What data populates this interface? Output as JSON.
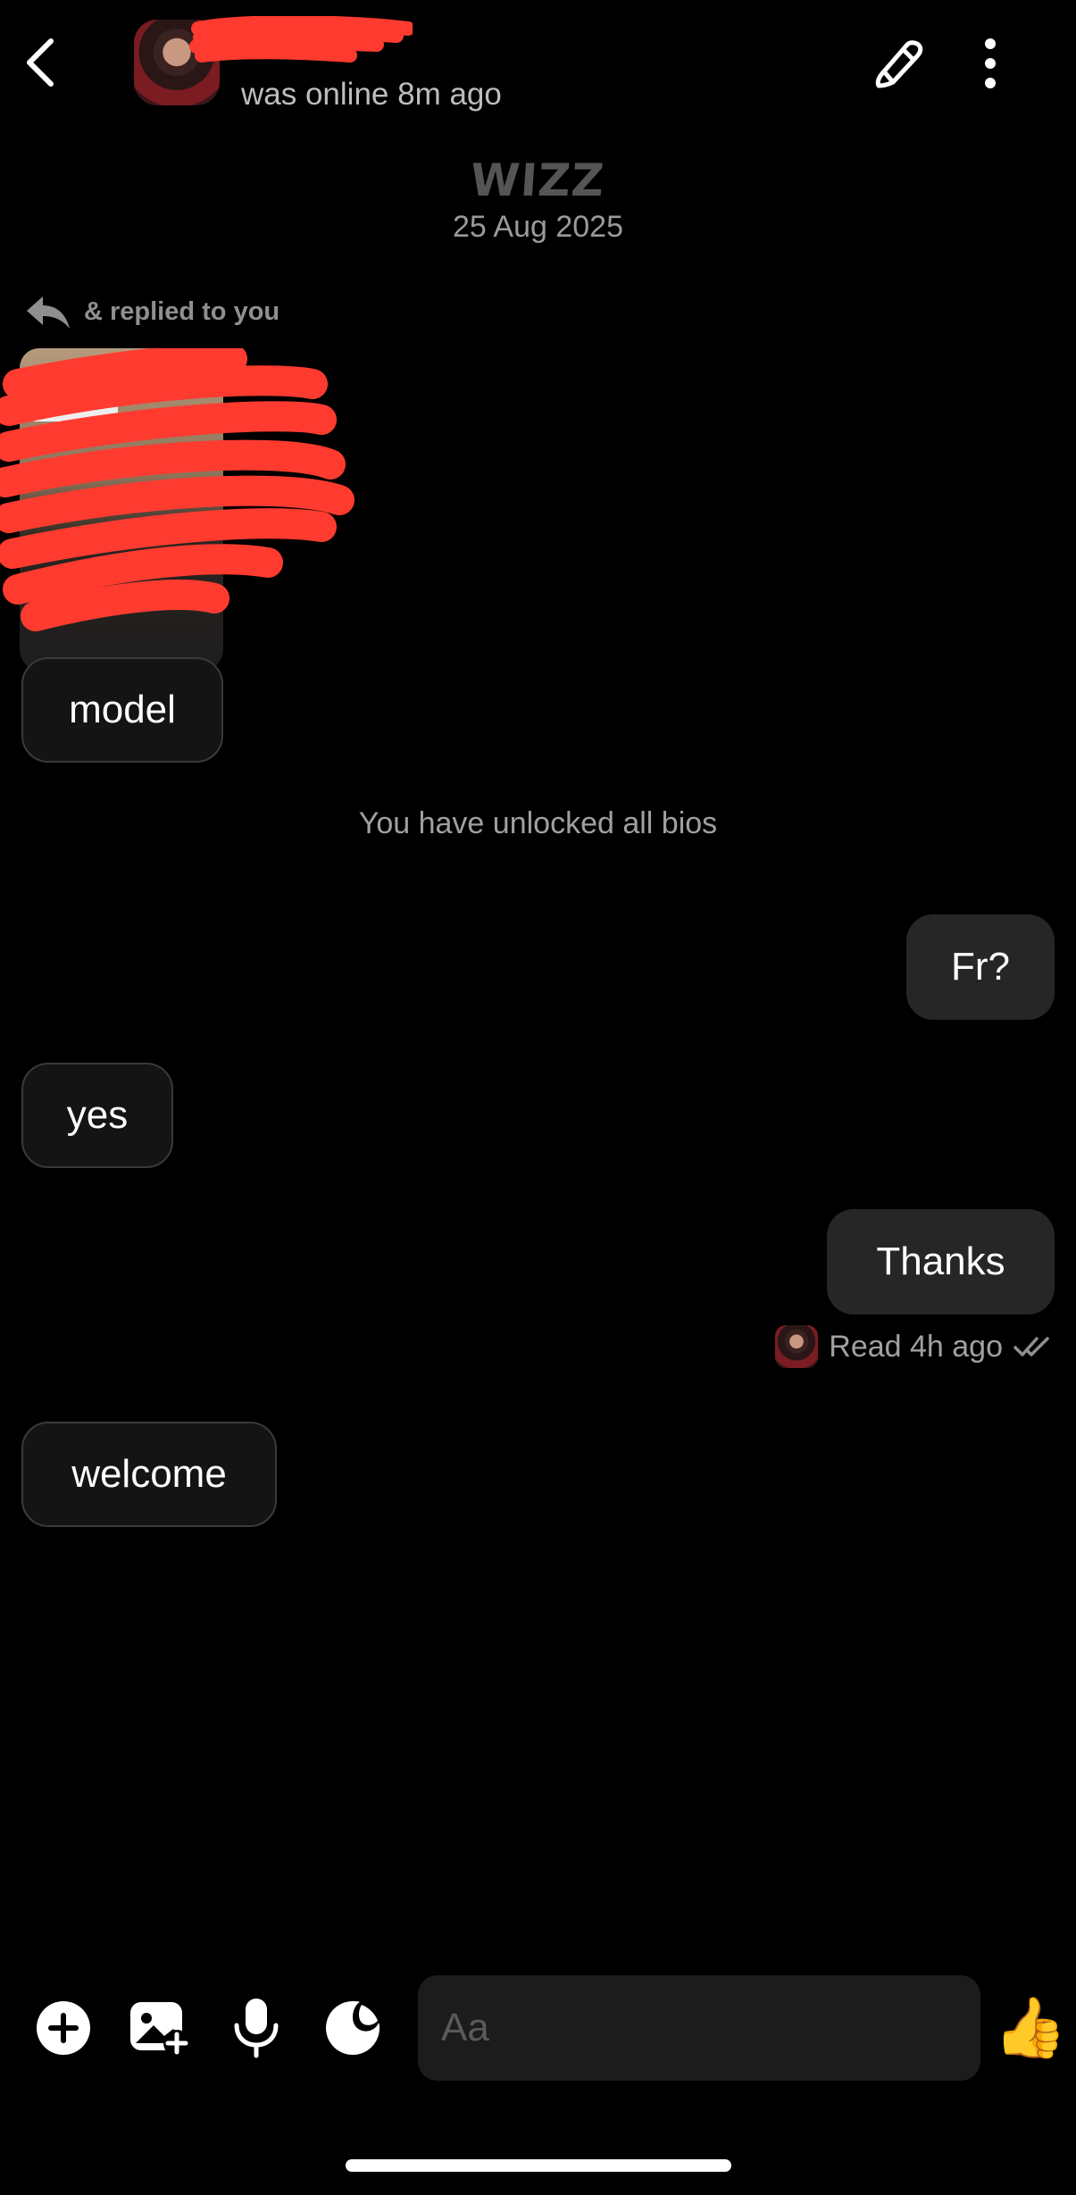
{
  "header": {
    "status": "was online 8m ago"
  },
  "date_header": {
    "logo_text": "WIZZ",
    "date": "25 Aug 2025"
  },
  "reply": {
    "label": "& replied to you"
  },
  "messages": [
    {
      "side": "in",
      "text": "model"
    },
    {
      "side": "out",
      "text": "Fr?"
    },
    {
      "side": "in",
      "text": "yes"
    },
    {
      "side": "out",
      "text": "Thanks"
    },
    {
      "side": "in",
      "text": "welcome"
    }
  ],
  "system_message": "You have unlocked all bios",
  "read_receipt": "Read 4h ago",
  "composer": {
    "placeholder": "Aa",
    "like_emoji": "👍"
  },
  "icons": [
    "back-icon",
    "pencil-icon",
    "more-vertical-icon",
    "reply-arrow-icon",
    "plus-icon",
    "add-photo-icon",
    "microphone-icon",
    "sticker-icon",
    "double-check-icon"
  ],
  "colors": {
    "background": "#000000",
    "incoming_bubble": "#141414",
    "outgoing_bubble": "#262626",
    "redaction": "#ff3b30"
  }
}
